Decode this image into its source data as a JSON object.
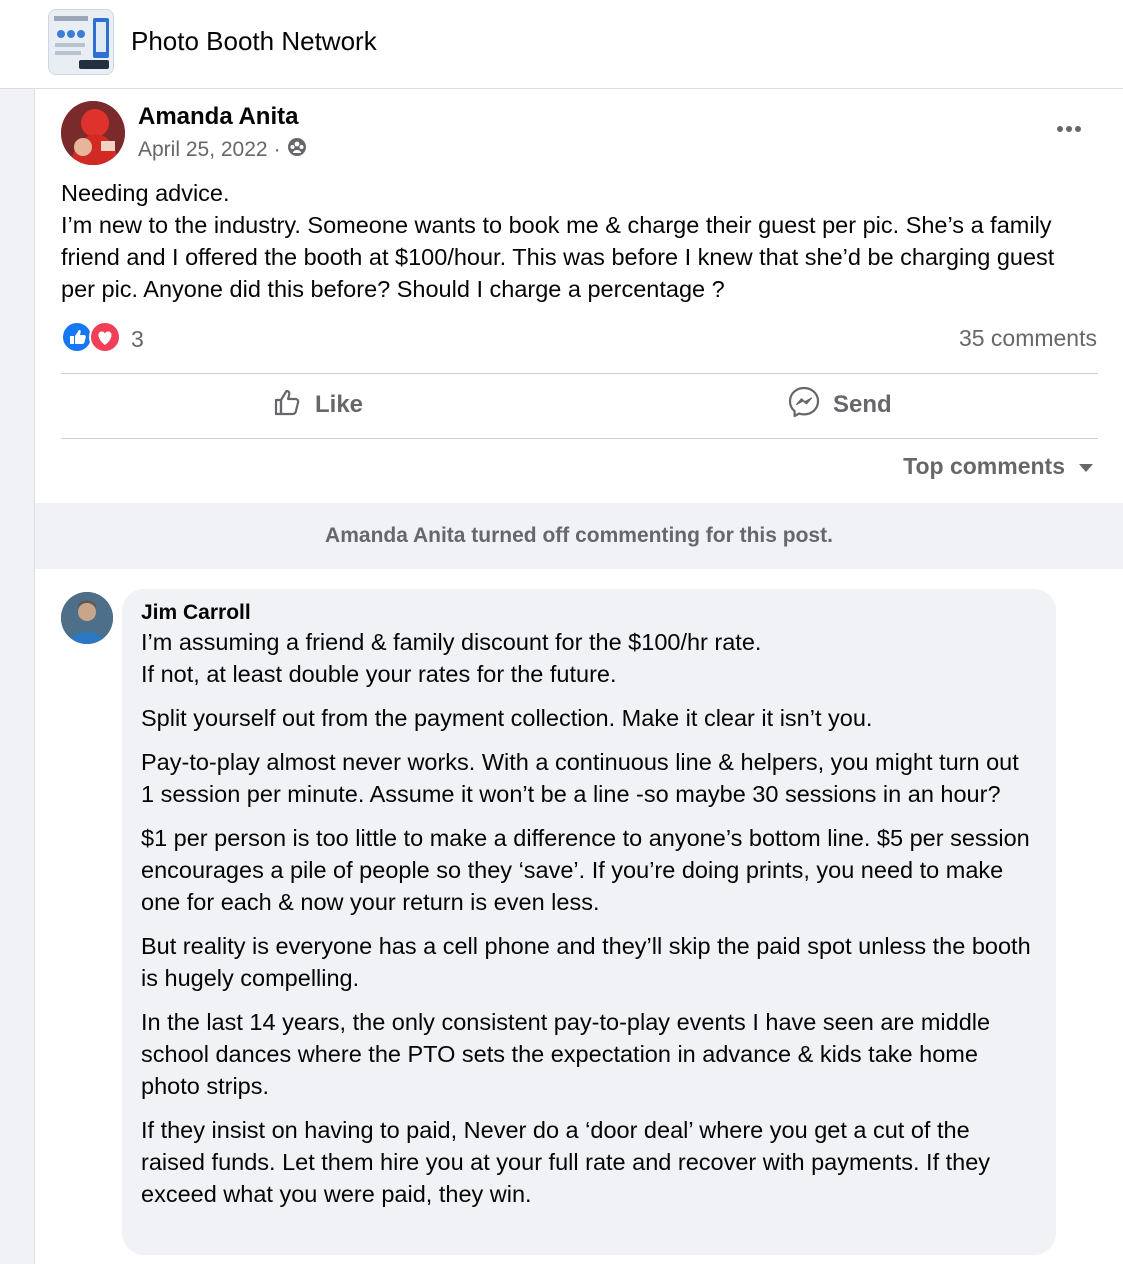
{
  "group": {
    "name": "Photo Booth Network"
  },
  "post": {
    "author": "Amanda Anita",
    "date": "April 25, 2022",
    "separator": "·",
    "body": [
      "Needing advice.",
      "I’m new to the industry. Someone wants to book me & charge their guest per pic. She’s a family friend and I offered the booth at $100/hour. This was before I knew that she’d be charging guest per pic. Anyone did this before? Should I charge a percentage ?"
    ],
    "reaction_count": "3",
    "comment_count": "35 comments",
    "actions": {
      "like": "Like",
      "send": "Send"
    },
    "sort_label": "Top comments",
    "notice": "Amanda Anita turned off commenting for this post."
  },
  "comment": {
    "author": "Jim Carroll",
    "paragraphs": [
      "I’m assuming a friend & family discount for the $100/hr rate.\nIf not, at least double your rates for the future.",
      "Split yourself out from the payment collection. Make it clear it isn’t you.",
      "Pay-to-play almost never works. With a continuous line & helpers, you might turn out 1 session per minute. Assume it won’t be a line -so maybe 30 sessions in an hour?",
      "$1 per person is too little to make a difference to anyone’s bottom line. $5 per session encourages a pile of people so they ‘save’. If you’re doing prints, you need to make one for each & now your return is even less.",
      "But reality is everyone has a cell phone and they’ll skip the paid spot unless the booth is hugely compelling.",
      "In the last 14 years, the only consistent pay-to-play events I have seen are middle school dances where the PTO sets the expectation in advance & kids take home photo strips.",
      "If they insist on having to paid, Never do a ‘door deal’ where you get a cut of the raised funds. Let them hire you at your full rate and recover with payments. If they exceed what you were paid, they win."
    ]
  },
  "icons": {
    "group_thumb": "group-thumbnail-icon",
    "audience": "group-audience-icon",
    "more": "more-options-icon",
    "like_reaction": "like-reaction-icon",
    "love_reaction": "love-reaction-icon",
    "like": "like-thumb-icon",
    "send": "messenger-send-icon",
    "sort": "caret-down-icon"
  },
  "colors": {
    "like_blue": "#1877f2",
    "love_red": "#f33e58",
    "secondary_text": "#65676b",
    "bubble_bg": "#f0f2f5"
  }
}
